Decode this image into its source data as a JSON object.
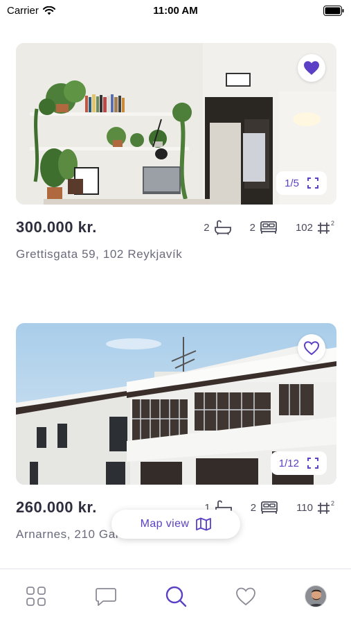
{
  "status_bar": {
    "carrier": "Carrier",
    "time": "11:00 AM"
  },
  "listings": [
    {
      "price": "300.000 kr.",
      "baths": "2",
      "beds": "2",
      "size": "102",
      "address": "Grettisgata 59, 102 Reykjavík",
      "photo_counter": "1/5",
      "favorited": true,
      "photo_description_icon": "apartment-interior-photo"
    },
    {
      "price": "260.000 kr.",
      "baths": "1",
      "beds": "2",
      "size": "110",
      "address": "Arnarnes, 210 Garðabær",
      "photo_counter": "1/12",
      "favorited": false,
      "photo_description_icon": "house-exterior-photo"
    }
  ],
  "map_view": {
    "label": "Map view"
  },
  "tab_bar": {
    "items": [
      "grid-icon",
      "chat-icon",
      "search-icon",
      "heart-icon",
      "avatar"
    ],
    "active": "search-icon"
  },
  "colors": {
    "accent": "#5b3fc4",
    "text": "#2e2e3e",
    "muted": "#6a6a7a"
  }
}
